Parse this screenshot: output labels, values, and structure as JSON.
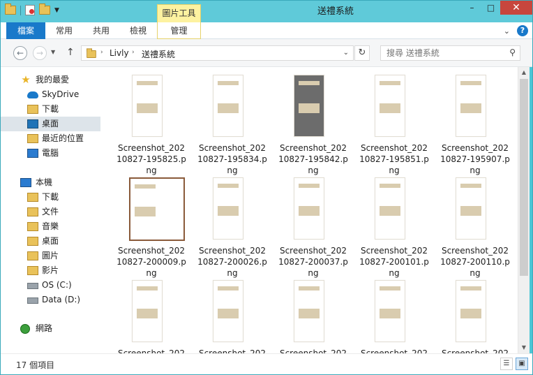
{
  "window": {
    "title": "送禮系統",
    "tool_tab": "圖片工具",
    "min": "–",
    "max": "□",
    "close": "✕"
  },
  "ribbon": {
    "tabs": [
      "檔案",
      "常用",
      "共用",
      "檢視",
      "管理"
    ]
  },
  "address": {
    "crumbs": [
      "Livly",
      "送禮系統"
    ],
    "search_placeholder": "搜尋 送禮系統"
  },
  "nav": {
    "favorites": {
      "label": "我的最愛",
      "items": [
        "SkyDrive",
        "下載",
        "桌面",
        "最近的位置",
        "電腦"
      ]
    },
    "pc": {
      "label": "本機",
      "items": [
        "下載",
        "文件",
        "音樂",
        "桌面",
        "圖片",
        "影片",
        "OS (C:)",
        "Data (D:)"
      ]
    },
    "network": "網路"
  },
  "files": [
    "Screenshot_20210827-195825.png",
    "Screenshot_20210827-195834.png",
    "Screenshot_20210827-195842.png",
    "Screenshot_20210827-195851.png",
    "Screenshot_20210827-195907.png",
    "Screenshot_20210827-200009.png",
    "Screenshot_20210827-200026.png",
    "Screenshot_20210827-200037.png",
    "Screenshot_20210827-200101.png",
    "Screenshot_20210827-200110.png",
    "Screenshot_202",
    "Screenshot_202",
    "Screenshot_202",
    "Screenshot_202",
    "Screenshot_202"
  ],
  "file_lines": [
    [
      "Screenshot_202",
      "10827-195825.p",
      "ng"
    ],
    [
      "Screenshot_202",
      "10827-195834.p",
      "ng"
    ],
    [
      "Screenshot_202",
      "10827-195842.p",
      "ng"
    ],
    [
      "Screenshot_202",
      "10827-195851.p",
      "ng"
    ],
    [
      "Screenshot_202",
      "10827-195907.p",
      "ng"
    ],
    [
      "Screenshot_202",
      "10827-200009.p",
      "ng"
    ],
    [
      "Screenshot_202",
      "10827-200026.p",
      "ng"
    ],
    [
      "Screenshot_202",
      "10827-200037.p",
      "ng"
    ],
    [
      "Screenshot_202",
      "10827-200101.p",
      "ng"
    ],
    [
      "Screenshot_202",
      "10827-200110.p",
      "ng"
    ],
    [
      "Screenshot_202"
    ],
    [
      "Screenshot_202"
    ],
    [
      "Screenshot_202"
    ],
    [
      "Screenshot_202"
    ],
    [
      "Screenshot_202"
    ]
  ],
  "status": {
    "count": "17 個項目"
  },
  "colors": {
    "titlebar": "#5fcad9",
    "file_tab": "#1979ca",
    "close": "#c7463d",
    "tool_tab": "#fdf2a0"
  }
}
